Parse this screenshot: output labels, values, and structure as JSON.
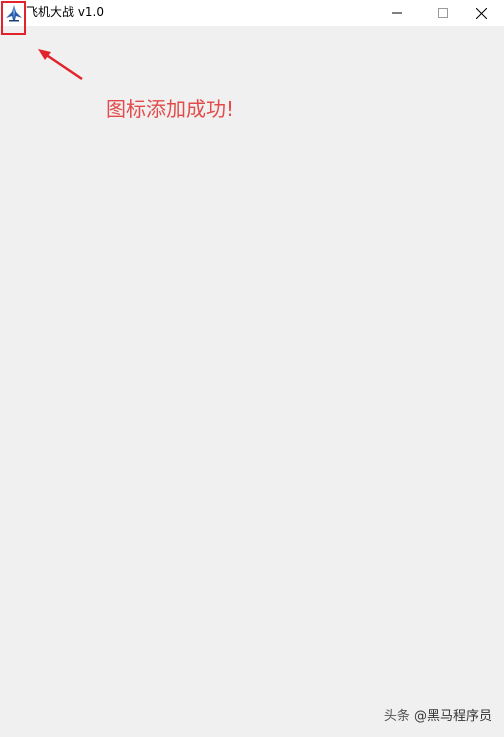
{
  "window": {
    "title": "飞机大战 v1.0",
    "app_icon": "plane-icon",
    "controls": {
      "minimize": "minimize-icon",
      "maximize": "maximize-icon",
      "close": "close-icon"
    }
  },
  "annotation": {
    "text": "图标添加成功!",
    "color": "#e34b4b",
    "highlight_color": "#e2232b",
    "arrow": "arrow-icon"
  },
  "watermark": {
    "prefix": "头条",
    "handle": "@黑马程序员"
  },
  "colors": {
    "titlebar": "#ffffff",
    "client_area": "#f0f0f0"
  }
}
